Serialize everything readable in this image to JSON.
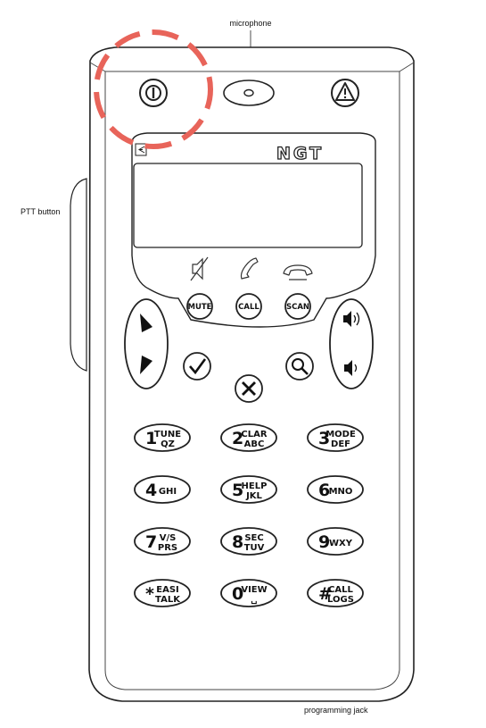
{
  "callouts": {
    "microphone": "microphone",
    "ptt": "PTT button",
    "programming_jack": "programming jack"
  },
  "brand": "NGT",
  "soft_keys": [
    {
      "label": "MUTE",
      "icon": "speaker-muted-icon"
    },
    {
      "label": "CALL",
      "icon": "handset-icon"
    },
    {
      "label": "SCAN",
      "icon": "handset-down-icon"
    }
  ],
  "icons": {
    "power": "power-icon",
    "alert": "alert-triangle-icon",
    "ok": "check-icon",
    "cancel": "x-icon",
    "search": "magnifier-icon",
    "up": "up-arrow-icon",
    "down": "down-arrow-icon",
    "vol_up": "volume-up-icon",
    "vol_down": "volume-down-icon",
    "display": "display-mode-icon"
  },
  "keypad": [
    {
      "main": "1",
      "top": "TUNE",
      "bottom": "QZ"
    },
    {
      "main": "2",
      "top": "CLAR",
      "bottom": "ABC"
    },
    {
      "main": "3",
      "top": "MODE",
      "bottom": "DEF"
    },
    {
      "main": "4",
      "top": "",
      "bottom": "GHI"
    },
    {
      "main": "5",
      "top": "HELP",
      "bottom": "JKL"
    },
    {
      "main": "6",
      "top": "",
      "bottom": "MNO"
    },
    {
      "main": "7",
      "top": "V/S",
      "bottom": "PRS"
    },
    {
      "main": "8",
      "top": "SEC",
      "bottom": "TUV"
    },
    {
      "main": "9",
      "top": "",
      "bottom": "WXY"
    },
    {
      "main": "*",
      "top": "EASI",
      "bottom": "TALK"
    },
    {
      "main": "0",
      "top": "VIEW",
      "bottom": "␣"
    },
    {
      "main": "#",
      "top": "CALL",
      "bottom": "LOGS"
    }
  ],
  "highlight_color": "#e8645a"
}
